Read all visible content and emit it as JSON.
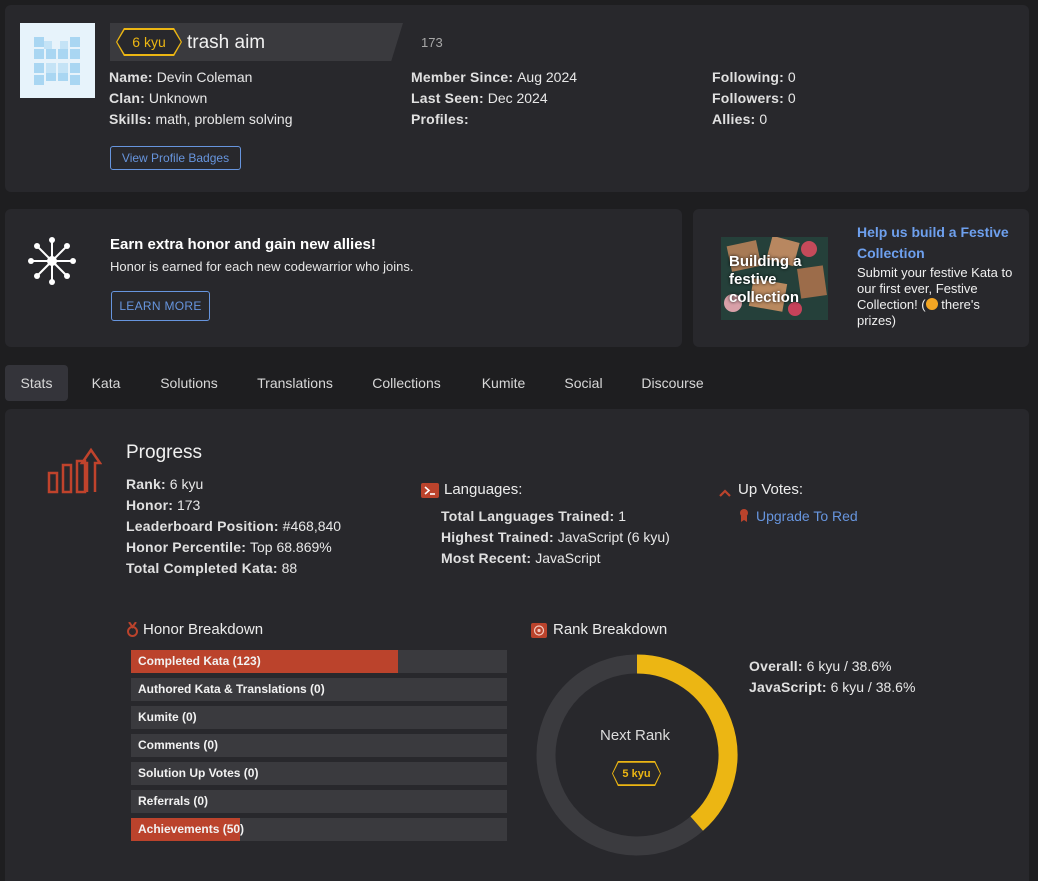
{
  "profile": {
    "rank_badge": "6 kyu",
    "username": "trash aim",
    "honor_count": "173",
    "col1": [
      {
        "label": "Name:",
        "value": "Devin Coleman"
      },
      {
        "label": "Clan:",
        "value": "Unknown"
      },
      {
        "label": "Skills:",
        "value": "math, problem solving"
      }
    ],
    "col2": [
      {
        "label": "Member Since:",
        "value": "Aug 2024"
      },
      {
        "label": "Last Seen:",
        "value": "Dec 2024"
      },
      {
        "label": "Profiles:",
        "value": ""
      }
    ],
    "col3": [
      {
        "label": "Following:",
        "value": "0"
      },
      {
        "label": "Followers:",
        "value": "0"
      },
      {
        "label": "Allies:",
        "value": "0"
      }
    ],
    "badges_button": "View Profile Badges"
  },
  "promo": {
    "title": "Earn extra honor and gain new allies!",
    "subtitle": "Honor is earned for each new codewarrior who joins.",
    "button": "LEARN MORE"
  },
  "festive": {
    "image_caption": "Building a festive collection",
    "title": "Help us build a Festive Collection",
    "body": "Submit your festive Kata to our first ever, Festive Collection! (",
    "body_tail": " there's prizes)"
  },
  "tabs": [
    "Stats",
    "Kata",
    "Solutions",
    "Translations",
    "Collections",
    "Kumite",
    "Social",
    "Discourse"
  ],
  "progress": {
    "title": "Progress",
    "rows": [
      {
        "label": "Rank:",
        "value": "6 kyu"
      },
      {
        "label": "Honor:",
        "value": "173"
      },
      {
        "label": "Leaderboard Position:",
        "value": "#468,840"
      },
      {
        "label": "Honor Percentile:",
        "value": "Top 68.869%"
      },
      {
        "label": "Total Completed Kata:",
        "value": "88"
      }
    ]
  },
  "languages": {
    "title": "Languages:",
    "rows": [
      {
        "label": "Total Languages Trained:",
        "value": "1"
      },
      {
        "label": "Highest Trained:",
        "value": "JavaScript (6 kyu)"
      },
      {
        "label": "Most Recent:",
        "value": "JavaScript"
      }
    ]
  },
  "upvotes": {
    "title": "Up Votes:",
    "link": "Upgrade To Red"
  },
  "honor_breakdown": {
    "title": "Honor Breakdown",
    "bars": [
      {
        "label": "Completed Kata (123)",
        "fill": 0.71
      },
      {
        "label": "Authored Kata & Translations (0)",
        "fill": 0
      },
      {
        "label": "Kumite (0)",
        "fill": 0
      },
      {
        "label": "Comments (0)",
        "fill": 0
      },
      {
        "label": "Solution Up Votes (0)",
        "fill": 0
      },
      {
        "label": "Referrals (0)",
        "fill": 0
      },
      {
        "label": "Achievements (50)",
        "fill": 0.29
      }
    ]
  },
  "rank_breakdown": {
    "title": "Rank Breakdown",
    "center_label": "Next Rank",
    "next_rank": "5 kyu",
    "progress": 0.386,
    "rows": [
      {
        "label": "Overall:",
        "value": "6 kyu / 38.6%"
      },
      {
        "label": "JavaScript:",
        "value": "6 kyu / 38.6%"
      }
    ]
  },
  "colors": {
    "accent_red": "#bb432c",
    "rank_yellow": "#ecb613",
    "link_blue": "#6795de",
    "panel": "#28282c"
  }
}
